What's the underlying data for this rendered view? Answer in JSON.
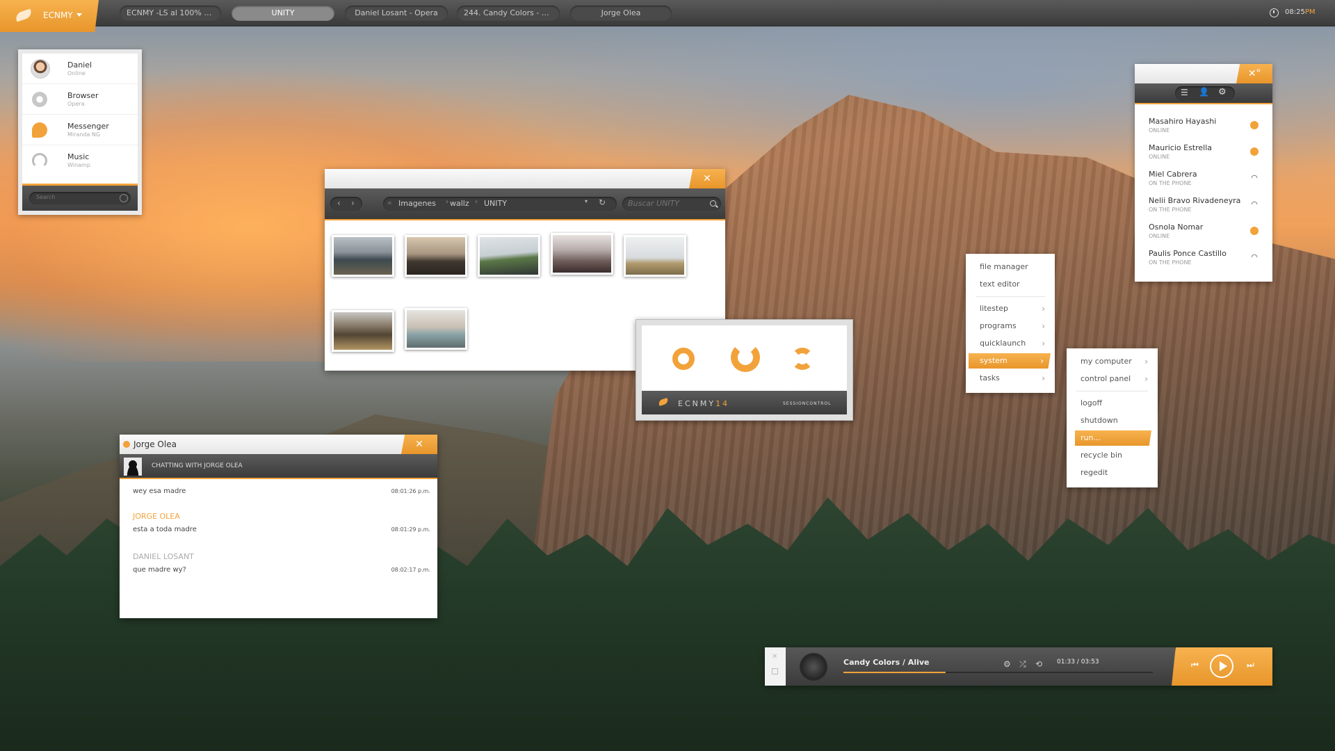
{
  "taskbar": {
    "start_label": "ECNMY",
    "tasks": [
      {
        "label": "ECNMY -LS al 100% (R..."
      },
      {
        "label": "UNITY"
      },
      {
        "label": "Daniel Losant - Opera"
      },
      {
        "label": "244. Candy Colors - A..."
      },
      {
        "label": "Jorge Olea"
      }
    ],
    "clock_time": "08:25",
    "clock_ampm": "PM"
  },
  "launcher": {
    "items": [
      {
        "title": "Daniel",
        "subtitle": "Online",
        "icon": "avatar"
      },
      {
        "title": "Browser",
        "subtitle": "Opera",
        "icon": "globe-icon"
      },
      {
        "title": "Messenger",
        "subtitle": "Miranda NG",
        "icon": "chat-icon"
      },
      {
        "title": "Music",
        "subtitle": "Winamp",
        "icon": "headphones-icon"
      }
    ],
    "search_placeholder": "Search"
  },
  "file_browser": {
    "breadcrumbs": [
      "Imagenes",
      "wallz",
      "UNITY"
    ],
    "search_placeholder": "Buscar UNITY",
    "thumbnails": 7
  },
  "session_control": {
    "brand": "ECNMY",
    "brand_number": "14",
    "subtitle": "SESSIONCONTROL"
  },
  "menu_main": {
    "items": [
      {
        "label": "file manager",
        "arrow": ""
      },
      {
        "label": "text editor",
        "arrow": ""
      },
      {
        "label": "litestep",
        "arrow": "›"
      },
      {
        "label": "programs",
        "arrow": "›"
      },
      {
        "label": "quicklaunch",
        "arrow": "›"
      },
      {
        "label": "system",
        "arrow": "›"
      },
      {
        "label": "tasks",
        "arrow": "›"
      }
    ]
  },
  "menu_system": {
    "items": [
      {
        "label": "my computer",
        "arrow": "›"
      },
      {
        "label": "control panel",
        "arrow": "›"
      },
      {
        "label": "logoff",
        "arrow": ""
      },
      {
        "label": "shutdown",
        "arrow": ""
      },
      {
        "label": "run...",
        "arrow": ""
      },
      {
        "label": "recycle bin",
        "arrow": ""
      },
      {
        "label": "regedit",
        "arrow": ""
      }
    ]
  },
  "contacts": {
    "list": [
      {
        "name": "Masahiro Hayashi",
        "status": "ONLINE",
        "icon": "online"
      },
      {
        "name": "Mauricio Estrella",
        "status": "ONLINE",
        "icon": "online"
      },
      {
        "name": "Miel Cabrera",
        "status": "ON THE PHONE",
        "icon": "phone"
      },
      {
        "name": "Nelii Bravo Rivadeneyra",
        "status": "ON THE PHONE",
        "icon": "phone"
      },
      {
        "name": "Osnola Nomar",
        "status": "ONLINE",
        "icon": "online"
      },
      {
        "name": "Paulis Ponce Castillo",
        "status": "ON THE PHONE",
        "icon": "phone"
      }
    ]
  },
  "chat": {
    "title": "Jorge Olea",
    "header": "CHATTING WITH JORGE OLEA",
    "messages": [
      {
        "sender": "",
        "text": "wey esa madre",
        "time": "08:01:26 p.m."
      },
      {
        "sender": "JORGE OLEA",
        "text": "esta a toda madre",
        "time": "08:01:29 p.m."
      },
      {
        "sender": "DANIEL LOSANT",
        "text": "que madre wy?",
        "time": "08:02:17 p.m."
      }
    ]
  },
  "player": {
    "track": "Candy Colors / Alive",
    "time": "01:33 / 03:53",
    "progress": 0.33
  },
  "colors": {
    "accent": "#f2a23a",
    "dark": "#3b3b3b"
  }
}
